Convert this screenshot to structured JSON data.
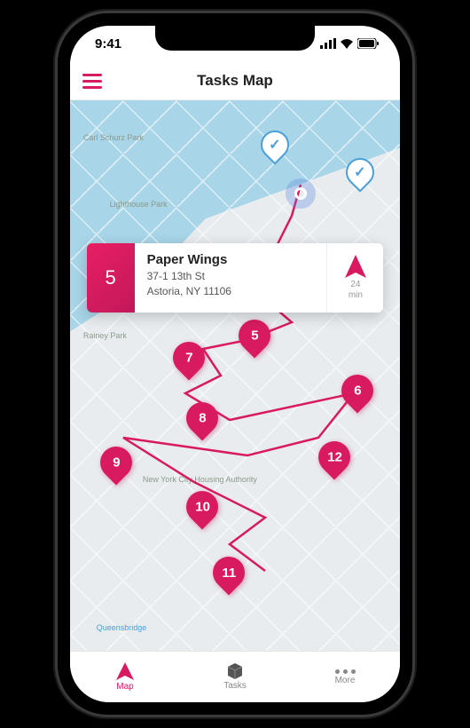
{
  "status": {
    "time": "9:41"
  },
  "header": {
    "title": "Tasks Map"
  },
  "info_card": {
    "number": "5",
    "name": "Paper Wings",
    "address_line1": "37-1 13th St",
    "address_line2": "Astoria, NY 11106",
    "eta_value": "24",
    "eta_unit": "min"
  },
  "pins": {
    "visible": [
      "5",
      "6",
      "7",
      "8",
      "9",
      "10",
      "11",
      "12"
    ],
    "completed_count": 2
  },
  "map_labels": {
    "park1": "Carl Schurz Park",
    "park2": "Lighthouse Park",
    "park3": "Rainey Park",
    "poi1": "New York City Housing Authority",
    "transit": "Queensbridge"
  },
  "nav": {
    "map": "Map",
    "tasks": "Tasks",
    "more": "More"
  },
  "colors": {
    "accent": "#d81b60"
  }
}
